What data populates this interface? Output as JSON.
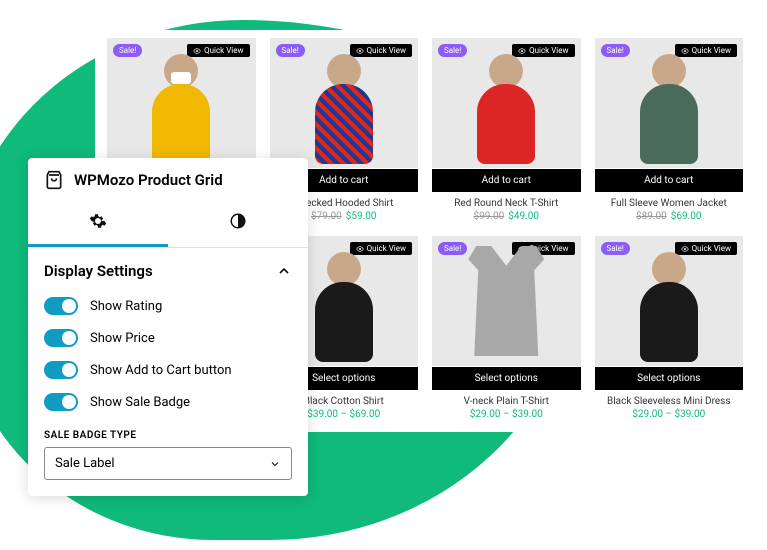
{
  "settings": {
    "title": "WPMozo Product Grid",
    "section": "Display Settings",
    "toggles": [
      {
        "label": "Show Rating"
      },
      {
        "label": "Show Price"
      },
      {
        "label": "Show Add to Cart button"
      },
      {
        "label": "Show Sale Badge"
      }
    ],
    "badge_type_label": "SALE BADGE TYPE",
    "badge_type_value": "Sale Label"
  },
  "common": {
    "sale_badge": "Sale!",
    "quick_view": "Quick View",
    "add_to_cart": "Add to cart",
    "select_options": "Select options"
  },
  "products_row1": [
    {
      "title": "",
      "old": "",
      "new": ""
    },
    {
      "title": "Checked Hooded Shirt",
      "old": "$79.00",
      "new": "$59.00"
    },
    {
      "title": "Red Round Neck T-Shirt",
      "old": "$99.00",
      "new": "$49.00"
    },
    {
      "title": "Full Sleeve Women Jacket",
      "old": "$89.00",
      "new": "$69.00"
    }
  ],
  "products_row2": [
    {
      "title": "Black Cotton Shirt",
      "range": "$39.00 – $69.00"
    },
    {
      "title": "V-neck Plain T-Shirt",
      "range": "$29.00 – $39.00"
    },
    {
      "title": "Black Sleeveless Mini Dress",
      "range": "$29.00 – $39.00"
    }
  ]
}
